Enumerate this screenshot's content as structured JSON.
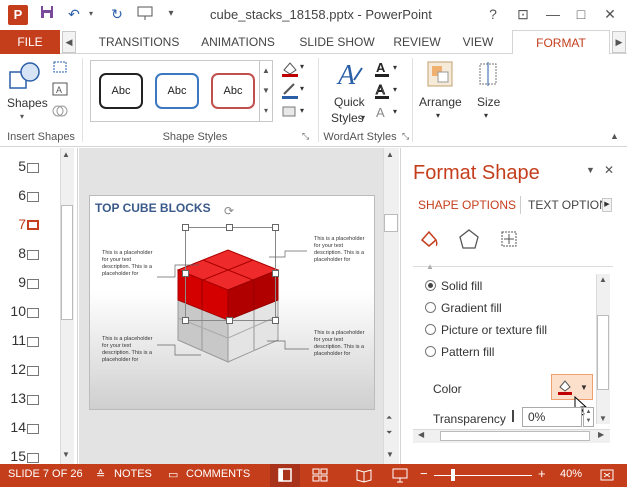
{
  "app": {
    "title": "cube_stacks_18158.pptx - PowerPoint",
    "logo": "P"
  },
  "window_controls": {
    "help": "?",
    "ribbon_options": "⊡",
    "minimize": "—",
    "restore": "□",
    "close": "✕"
  },
  "tabs": {
    "file": "FILE",
    "items": [
      "TRANSITIONS",
      "ANIMATIONS",
      "SLIDE SHOW",
      "REVIEW",
      "VIEW",
      "FORMAT"
    ],
    "active": "FORMAT"
  },
  "ribbon": {
    "insert_shapes": {
      "label": "Insert Shapes",
      "shapes_label": "Shapes"
    },
    "shape_styles": {
      "label": "Shape Styles",
      "styles": [
        "Abc",
        "Abc",
        "Abc"
      ]
    },
    "wordart": {
      "label": "WordArt Styles",
      "quick_styles": "Quick\nStyles",
      "quick_line1": "Quick",
      "quick_line2": "Styles"
    },
    "arrange": {
      "label": "Arrange"
    },
    "size": {
      "label": "Size"
    }
  },
  "thumbnails": {
    "items": [
      "5",
      "6",
      "7",
      "8",
      "9",
      "10",
      "11",
      "12",
      "13",
      "14",
      "15"
    ],
    "active": "7"
  },
  "slide": {
    "title": "TOP CUBE BLOCKS",
    "placeholder_text": "This is a placeholder for your text description. This is a placeholder for"
  },
  "format_pane": {
    "title": "Format Shape",
    "tab_shape": "SHAPE OPTIONS",
    "tab_text": "TEXT OPTION",
    "fill_options": [
      "Solid fill",
      "Gradient fill",
      "Picture or texture fill",
      "Pattern fill"
    ],
    "selected_fill": "Solid fill",
    "color_label": "Color",
    "transparency_label": "Transparency",
    "transparency_value": "0%",
    "fill_color": "#c00000"
  },
  "statusbar": {
    "slide_info": "SLIDE 7 OF 26",
    "notes": "NOTES",
    "comments": "COMMENTS",
    "zoom": "40%"
  },
  "colors": {
    "accent": "#c43e1c",
    "title_blue": "#3a5a8a",
    "cube_red": "#d40000"
  }
}
